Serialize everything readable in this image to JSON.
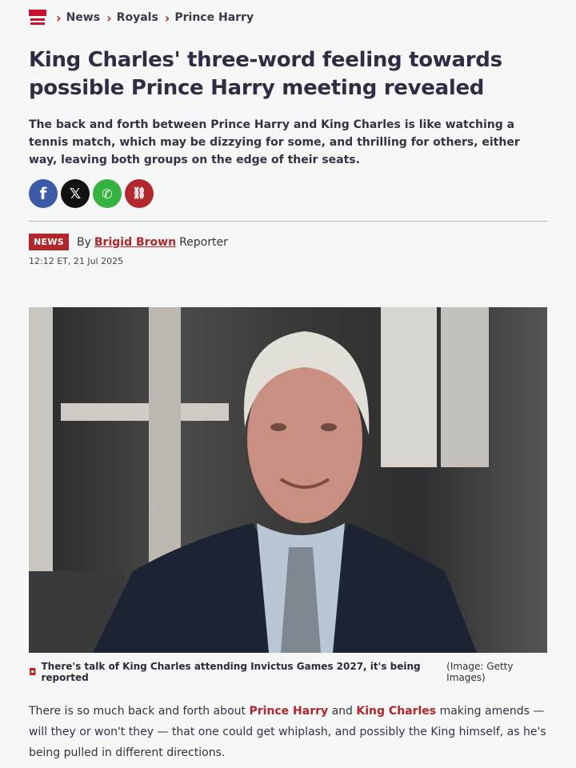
{
  "breadcrumb": {
    "items": [
      "News",
      "Royals",
      "Prince Harry"
    ]
  },
  "headline": "King Charles' three-word feeling towards possible Prince Harry meeting revealed",
  "standfirst": "The back and forth between Prince Harry and King Charles is like watching a tennis match, which may be dizzying for some, and thrilling for others, either way, leaving both groups on the edge of their seats.",
  "share": {
    "facebook": "f",
    "x": "𝕏",
    "whatsapp": "✆",
    "link": "⛓"
  },
  "byline": {
    "badge": "NEWS",
    "by": "By",
    "author": "Brigid Brown",
    "role": "Reporter",
    "timestamp": "12:12 ET, 21 Jul 2025"
  },
  "caption": {
    "text": "There's talk of King Charles attending Invictus Games 2027, it's being reported",
    "credit": "(Image: Getty Images)"
  },
  "body": {
    "p1_a": "There is so much back and forth about ",
    "link1": "Prince Harry",
    "p1_b": " and ",
    "link2": "King Charles",
    "p1_c": " making amends — will they or won't they — that one could get whiplash, and possibly the King himself, as he's being pulled in different directions."
  },
  "colors": {
    "accent": "#b3262b",
    "facebook": "#3b5aa8",
    "whatsapp": "#35b340"
  }
}
